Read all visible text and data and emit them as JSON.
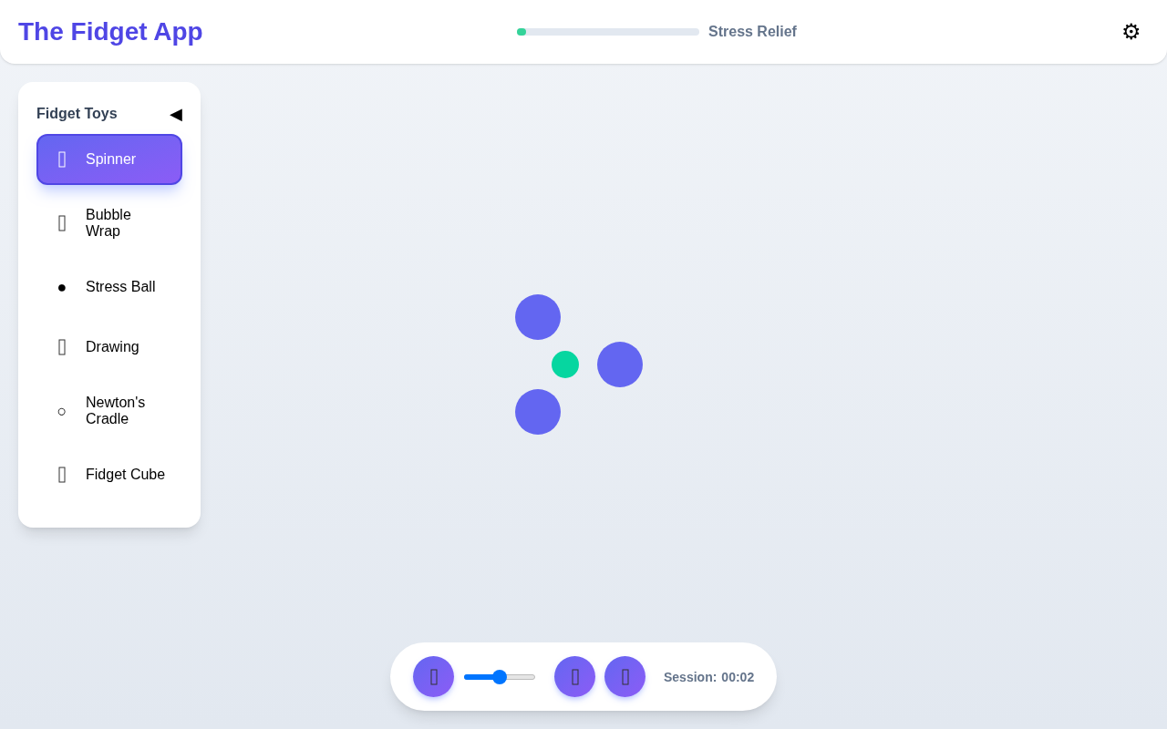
{
  "header": {
    "title": "The Fidget App",
    "progress": {
      "level": 0.05,
      "label": "Stress Relief"
    },
    "settings": "⚙"
  },
  "sidebar": {
    "title": "Fidget Toys",
    "collapse": "◀",
    "items": [
      {
        "label": "Spinner",
        "kind": "missing",
        "selected": true
      },
      {
        "label": "Bubble Wrap",
        "kind": "missing",
        "selected": false
      },
      {
        "label": "Stress Ball",
        "kind": "glyph",
        "glyph": "●",
        "selected": false
      },
      {
        "label": "Drawing",
        "kind": "missing",
        "selected": false
      },
      {
        "label": "Newton's Cradle",
        "kind": "glyph",
        "glyph": "○",
        "selected": false
      },
      {
        "label": "Fidget Cube",
        "kind": "missing",
        "selected": false
      }
    ]
  },
  "controls": {
    "speed": {
      "level": 0.5
    },
    "session_label": "Session:",
    "session_time": "00:02"
  }
}
